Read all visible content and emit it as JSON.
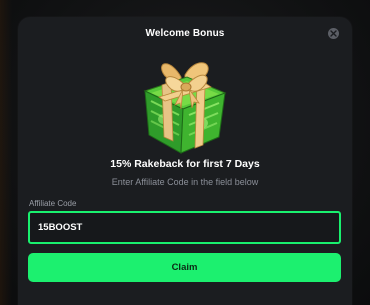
{
  "modal": {
    "title": "Welcome Bonus",
    "headline": "15% Rakeback for first 7 Days",
    "subline": "Enter Affiliate Code in the field below"
  },
  "affiliate": {
    "label": "Affiliate Code",
    "value": "15BOOST"
  },
  "actions": {
    "claim_label": "Claim"
  },
  "icons": {
    "close": "close-icon",
    "gift": "gift-box-icon"
  },
  "colors": {
    "accent": "#1cf06f",
    "modal_bg": "#1b1d20",
    "page_bg": "#0e0f10"
  }
}
